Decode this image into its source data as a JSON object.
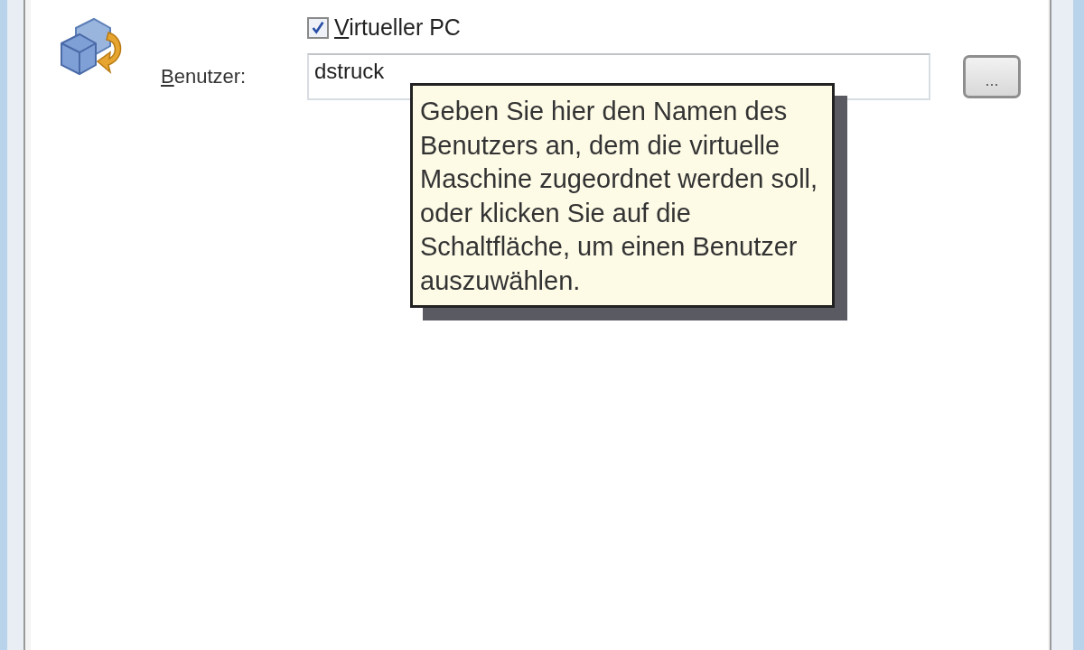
{
  "checkbox": {
    "label": "Virtueller PC",
    "checked": true
  },
  "user_field": {
    "label": "Benutzer:",
    "value": "dstruck"
  },
  "browse_button": {
    "label": "..."
  },
  "tooltip": {
    "text": "Geben Sie hier den Namen des Benutzers an, dem die virtuelle Maschine zugeordnet werden soll, oder klicken Sie auf die Schaltfläche, um einen Benutzer auszuwählen."
  }
}
